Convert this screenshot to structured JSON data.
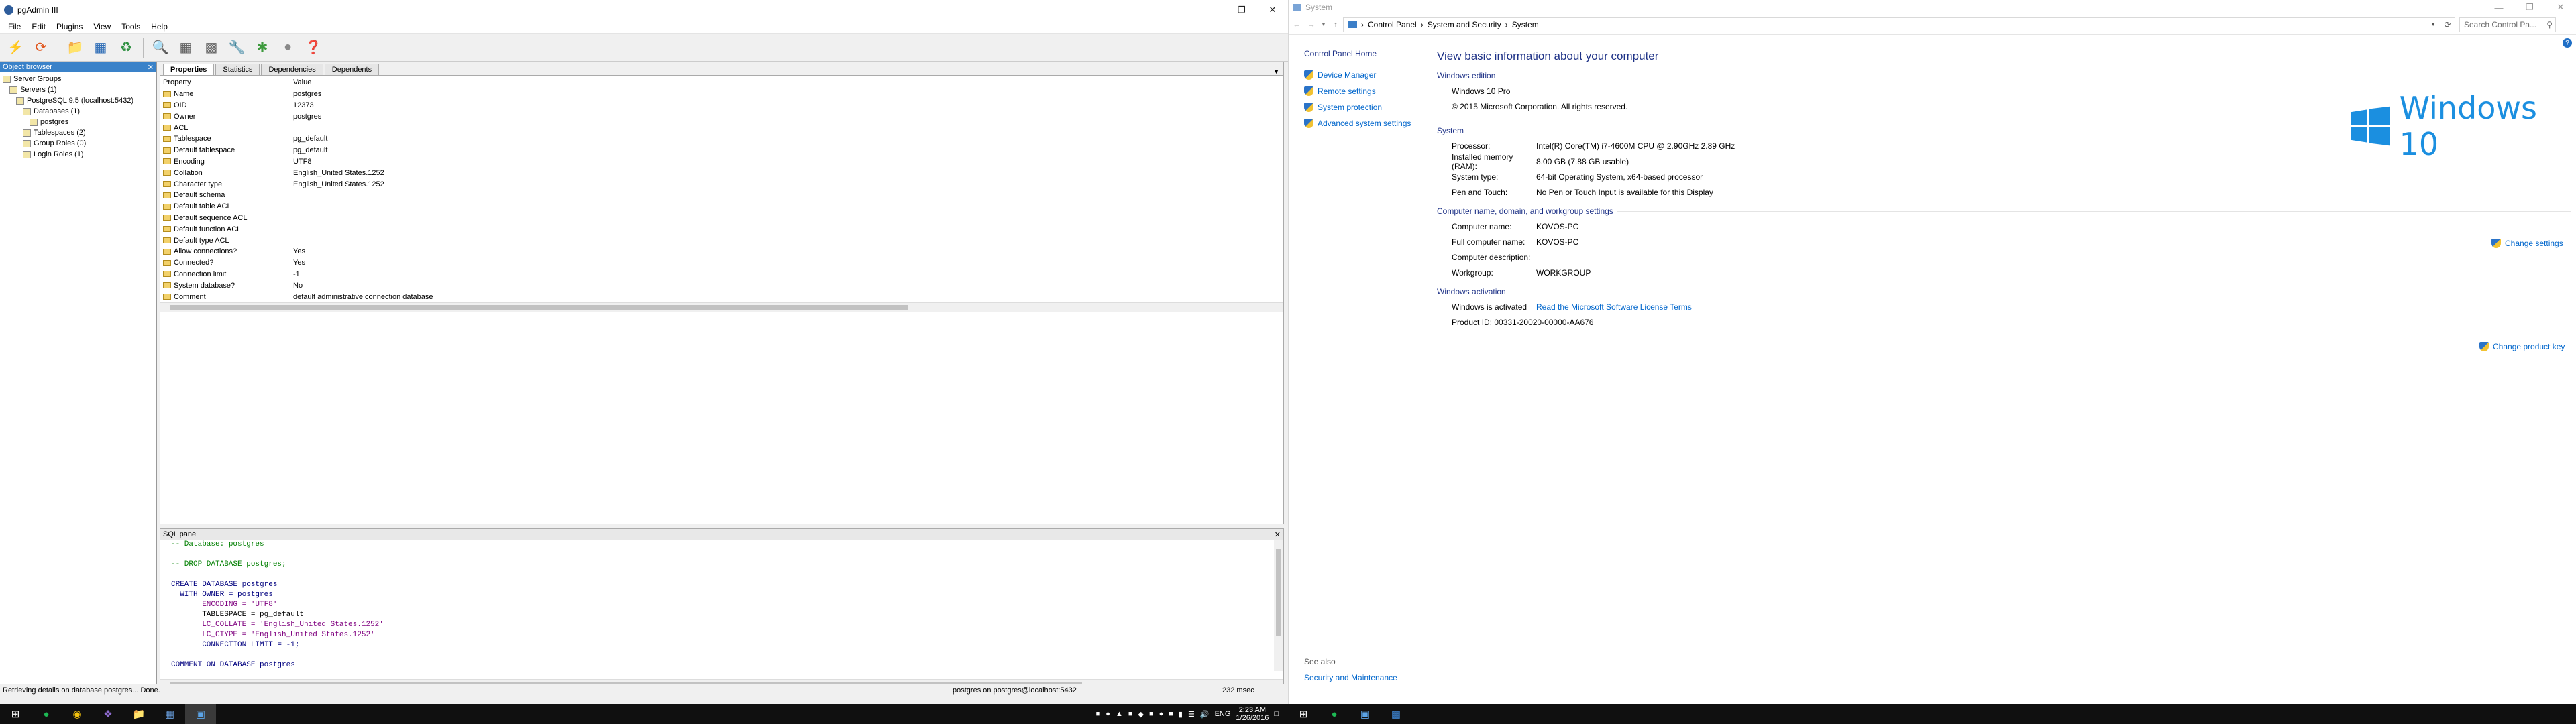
{
  "pgadmin": {
    "title": "pgAdmin III",
    "menu": [
      "File",
      "Edit",
      "Plugins",
      "View",
      "Tools",
      "Help"
    ],
    "toolbar_icons": [
      "connect-icon",
      "refresh-icon",
      "create-object-icon",
      "drop-object-icon",
      "properties-icon",
      "sql-icon",
      "view-data-icon",
      "view-filtered-data-icon",
      "maintenance-icon",
      "plugins-icon",
      "guru-hint-icon",
      "help-icon"
    ],
    "object_browser": {
      "title": "Object browser",
      "nodes": [
        {
          "label": "Server Groups",
          "depth": 0
        },
        {
          "label": "Servers (1)",
          "depth": 1
        },
        {
          "label": "PostgreSQL 9.5 (localhost:5432)",
          "depth": 2
        },
        {
          "label": "Databases (1)",
          "depth": 3
        },
        {
          "label": "postgres",
          "depth": 4
        },
        {
          "label": "Tablespaces (2)",
          "depth": 3
        },
        {
          "label": "Group Roles (0)",
          "depth": 3
        },
        {
          "label": "Login Roles (1)",
          "depth": 3
        }
      ]
    },
    "tabs": [
      "Properties",
      "Statistics",
      "Dependencies",
      "Dependents"
    ],
    "props_header": {
      "property": "Property",
      "value": "Value"
    },
    "properties": [
      {
        "k": "Name",
        "v": "postgres"
      },
      {
        "k": "OID",
        "v": "12373"
      },
      {
        "k": "Owner",
        "v": "postgres"
      },
      {
        "k": "ACL",
        "v": ""
      },
      {
        "k": "Tablespace",
        "v": "pg_default"
      },
      {
        "k": "Default tablespace",
        "v": "pg_default"
      },
      {
        "k": "Encoding",
        "v": "UTF8"
      },
      {
        "k": "Collation",
        "v": "English_United States.1252"
      },
      {
        "k": "Character type",
        "v": "English_United States.1252"
      },
      {
        "k": "Default schema",
        "v": ""
      },
      {
        "k": "Default table ACL",
        "v": ""
      },
      {
        "k": "Default sequence ACL",
        "v": ""
      },
      {
        "k": "Default function ACL",
        "v": ""
      },
      {
        "k": "Default type ACL",
        "v": ""
      },
      {
        "k": "Allow connections?",
        "v": "Yes"
      },
      {
        "k": "Connected?",
        "v": "Yes"
      },
      {
        "k": "Connection limit",
        "v": "-1"
      },
      {
        "k": "System database?",
        "v": "No"
      },
      {
        "k": "Comment",
        "v": "default administrative connection database"
      }
    ],
    "sql_pane": {
      "title": "SQL pane",
      "lines": [
        {
          "t": "-- Database: postgres",
          "c": "cm"
        },
        {
          "t": "",
          "c": ""
        },
        {
          "t": "-- DROP DATABASE postgres;",
          "c": "cm"
        },
        {
          "t": "",
          "c": ""
        },
        {
          "t": "CREATE DATABASE postgres",
          "c": "kw"
        },
        {
          "t": "  WITH OWNER = postgres",
          "c": "kw"
        },
        {
          "t": "       ENCODING = 'UTF8'",
          "c": "st"
        },
        {
          "t": "       TABLESPACE = pg_default",
          "c": ""
        },
        {
          "t": "       LC_COLLATE = 'English_United States.1252'",
          "c": "st"
        },
        {
          "t": "       LC_CTYPE = 'English_United States.1252'",
          "c": "st"
        },
        {
          "t": "       CONNECTION LIMIT = -1;",
          "c": "kw"
        },
        {
          "t": "",
          "c": ""
        },
        {
          "t": "COMMENT ON DATABASE postgres",
          "c": "kw"
        }
      ]
    },
    "status": {
      "left": "Retrieving details on database postgres... Done.",
      "center": "postgres on postgres@localhost:5432",
      "right": "232 msec"
    }
  },
  "system": {
    "title": "System",
    "breadcrumb": [
      "Control Panel",
      "System and Security",
      "System"
    ],
    "search_placeholder": "Search Control Pa...",
    "side": {
      "home": "Control Panel Home",
      "links": [
        "Device Manager",
        "Remote settings",
        "System protection",
        "Advanced system settings"
      ],
      "see_also": "See also",
      "security": "Security and Maintenance"
    },
    "heading": "View basic information about your computer",
    "logo_text": "Windows 10",
    "edition": {
      "header": "Windows edition",
      "name": "Windows 10 Pro",
      "copyright": "© 2015 Microsoft Corporation. All rights reserved."
    },
    "system_section": {
      "header": "System",
      "rows": [
        {
          "k": "Processor:",
          "v": "Intel(R) Core(TM) i7-4600M CPU @ 2.90GHz   2.89 GHz"
        },
        {
          "k": "Installed memory (RAM):",
          "v": "8.00 GB (7.88 GB usable)"
        },
        {
          "k": "System type:",
          "v": "64-bit Operating System, x64-based processor"
        },
        {
          "k": "Pen and Touch:",
          "v": "No Pen or Touch Input is available for this Display"
        }
      ]
    },
    "computer_section": {
      "header": "Computer name, domain, and workgroup settings",
      "rows": [
        {
          "k": "Computer name:",
          "v": "KOVOS-PC"
        },
        {
          "k": "Full computer name:",
          "v": "KOVOS-PC"
        },
        {
          "k": "Computer description:",
          "v": ""
        },
        {
          "k": "Workgroup:",
          "v": "WORKGROUP"
        }
      ],
      "change": "Change settings"
    },
    "activation": {
      "header": "Windows activation",
      "status": "Windows is activated",
      "license_link": "Read the Microsoft Software License Terms",
      "product_id": "Product ID: 00331-20020-00000-AA676",
      "change_key": "Change product key"
    }
  },
  "taskbar": {
    "lang": "ENG",
    "time": "2:23 AM",
    "date": "1/26/2016"
  },
  "colors": {
    "accent": "#3a82c9",
    "link": "#0066cc",
    "heading": "#1e3287",
    "win_logo": "#1b8fe0"
  }
}
